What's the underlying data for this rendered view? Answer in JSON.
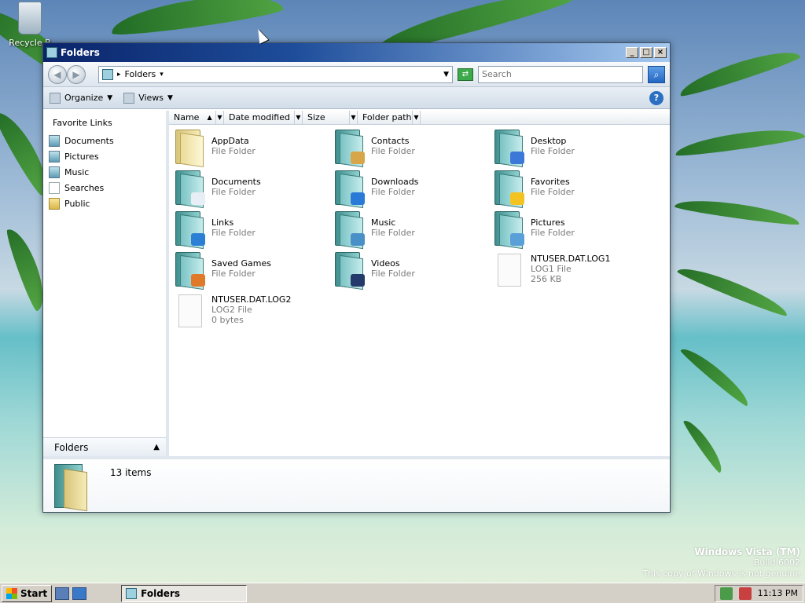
{
  "desktop": {
    "recycle_bin_label": "Recycle B"
  },
  "window": {
    "title": "Folders",
    "buttons": {
      "minimize": "_",
      "maximize": "□",
      "close": "×"
    }
  },
  "address_bar": {
    "location": "Folders",
    "search_placeholder": "Search"
  },
  "toolbar": {
    "organize_label": "Organize",
    "views_label": "Views",
    "help_label": "?"
  },
  "nav_pane": {
    "heading": "Favorite Links",
    "items": [
      {
        "label": "Documents",
        "icon": "documents-icon"
      },
      {
        "label": "Pictures",
        "icon": "pictures-icon"
      },
      {
        "label": "Music",
        "icon": "music-icon"
      },
      {
        "label": "Searches",
        "icon": "searches-icon"
      },
      {
        "label": "Public",
        "icon": "public-folder-icon"
      }
    ],
    "folders_label": "Folders"
  },
  "columns": [
    "Name",
    "Date modified",
    "Size",
    "Folder path"
  ],
  "items": [
    {
      "name": "AppData",
      "type": "File Folder",
      "extra": "",
      "icon": "appdata-folder-icon"
    },
    {
      "name": "Contacts",
      "type": "File Folder",
      "extra": "",
      "icon": "contacts-folder-icon"
    },
    {
      "name": "Desktop",
      "type": "File Folder",
      "extra": "",
      "icon": "desktop-folder-icon"
    },
    {
      "name": "Documents",
      "type": "File Folder",
      "extra": "",
      "icon": "documents-folder-icon"
    },
    {
      "name": "Downloads",
      "type": "File Folder",
      "extra": "",
      "icon": "downloads-folder-icon"
    },
    {
      "name": "Favorites",
      "type": "File Folder",
      "extra": "",
      "icon": "favorites-folder-icon"
    },
    {
      "name": "Links",
      "type": "File Folder",
      "extra": "",
      "icon": "links-folder-icon"
    },
    {
      "name": "Music",
      "type": "File Folder",
      "extra": "",
      "icon": "music-folder-icon"
    },
    {
      "name": "Pictures",
      "type": "File Folder",
      "extra": "",
      "icon": "pictures-folder-icon"
    },
    {
      "name": "Saved Games",
      "type": "File Folder",
      "extra": "",
      "icon": "saved-games-folder-icon"
    },
    {
      "name": "Videos",
      "type": "File Folder",
      "extra": "",
      "icon": "videos-folder-icon"
    },
    {
      "name": "NTUSER.DAT.LOG1",
      "type": "LOG1 File",
      "extra": "256 KB",
      "icon": "file-icon"
    },
    {
      "name": "NTUSER.DAT.LOG2",
      "type": "LOG2 File",
      "extra": "0 bytes",
      "icon": "file-icon"
    }
  ],
  "details_pane": {
    "count_text": "13 items"
  },
  "watermark": {
    "line1": "Windows Vista (TM)",
    "line2": "Build 6002",
    "line3": "This copy of Windows is not genuine"
  },
  "taskbar": {
    "start_label": "Start",
    "task_label": "Folders",
    "clock": "11:13 PM"
  }
}
